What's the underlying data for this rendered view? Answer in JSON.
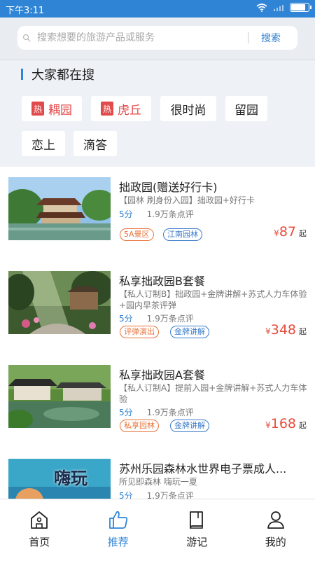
{
  "status": {
    "time": "下午3:11"
  },
  "search": {
    "placeholder": "搜索想要的旅游产品或服务",
    "button": "搜索"
  },
  "hot_section": {
    "title": "大家都在搜",
    "hot_mark": "热",
    "tags": [
      "耦园",
      "虎丘",
      "很时尚",
      "留园",
      "恋上",
      "滴答"
    ]
  },
  "items": [
    {
      "title": "拙政园(赠送好行卡)",
      "desc": "【园林 刷身份入园】拙政园+好行卡",
      "score": "5分",
      "reviews": "1.9万条点评",
      "badges": [
        "5A景区",
        "江南园林"
      ],
      "price_symbol": "¥",
      "price": "87",
      "price_suffix": "起"
    },
    {
      "title": "私享拙政园B套餐",
      "desc": "【私人订制B】拙政园+金牌讲解+苏式人力车体验+园内早茶评弹",
      "score": "5分",
      "reviews": "1.9万条点评",
      "badges": [
        "评弹演出",
        "金牌讲解"
      ],
      "price_symbol": "¥",
      "price": "348",
      "price_suffix": "起"
    },
    {
      "title": "私享拙政园A套餐",
      "desc": "【私人订制A】提前入园+金牌讲解+苏式人力车体验",
      "score": "5分",
      "reviews": "1.9万条点评",
      "badges": [
        "私享园林",
        "金牌讲解"
      ],
      "price_symbol": "¥",
      "price": "168",
      "price_suffix": "起"
    },
    {
      "title": "苏州乐园森林水世界电子票成人...",
      "desc": "所见即森林 嗨玩一夏",
      "score": "5分",
      "reviews": "1.9万条点评",
      "thumb_text": "嗨玩"
    }
  ],
  "tabbar": {
    "tabs": [
      "首页",
      "推荐",
      "游记",
      "我的"
    ],
    "active": "推荐"
  },
  "colors": {
    "brand": "#2f84d6",
    "price": "#e74c3c",
    "hot": "#e24b4b"
  }
}
